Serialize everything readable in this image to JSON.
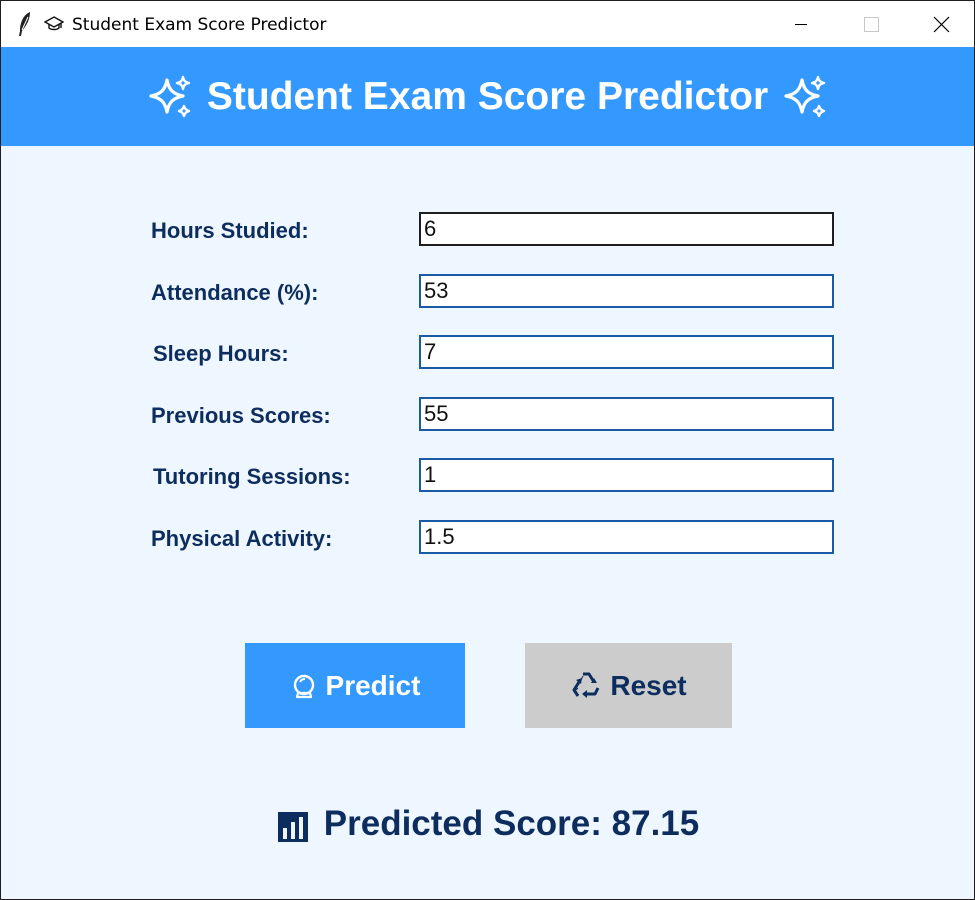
{
  "window": {
    "title": "Student Exam Score Predictor",
    "icons": [
      "feather-icon",
      "graduation-cap-icon"
    ],
    "controls": [
      "minimize-icon",
      "maximize-icon",
      "close-icon"
    ]
  },
  "header": {
    "title": "Student Exam Score Predictor",
    "icon_left": "sparkles-icon",
    "icon_right": "sparkles-icon",
    "background": "#3399ff"
  },
  "form": {
    "fields": [
      {
        "label": "Hours Studied:",
        "value": "6"
      },
      {
        "label": "Attendance (%):",
        "value": "53"
      },
      {
        "label": "Sleep Hours:",
        "value": "7"
      },
      {
        "label": "Previous Scores:",
        "value": "55"
      },
      {
        "label": "Tutoring Sessions:",
        "value": "1"
      },
      {
        "label": "Physical Activity:",
        "value": "1.5"
      }
    ]
  },
  "buttons": {
    "predict": {
      "label": "Predict",
      "icon": "crystal-ball-icon",
      "color": "#3399ff"
    },
    "reset": {
      "label": "Reset",
      "icon": "recycle-icon",
      "color": "#cccccc"
    }
  },
  "result": {
    "icon": "bar-chart-icon",
    "text": "Predicted Score: 87.15",
    "color": "#0d2d5e"
  }
}
